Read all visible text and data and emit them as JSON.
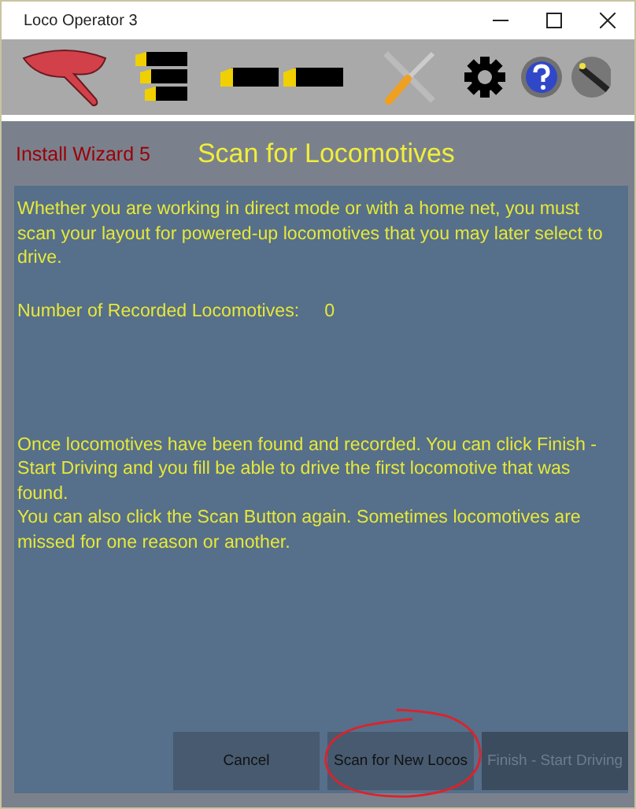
{
  "window": {
    "title": "Loco Operator 3"
  },
  "toolbar": {
    "tools": [
      {
        "kind": "paddle"
      },
      {
        "kind": "trains"
      },
      {
        "kind": "locos"
      },
      {
        "kind": "tools"
      },
      {
        "kind": "gear"
      },
      {
        "kind": "help"
      },
      {
        "kind": "wand"
      }
    ]
  },
  "header": {
    "step": "Install Wizard 5",
    "title": "Scan for Locomotives"
  },
  "panel": {
    "intro": "Whether you are working in direct mode or with a home net, you must scan your layout for powered-up locomotives that you may later select to drive.",
    "count_label": "Number of Recorded Locomotives:",
    "count_value": "0",
    "notes": [
      "Once locomotives have been found and recorded. You can click Finish - Start Driving and you fill be able to drive  the first locomotive that was found.",
      "You can also click the Scan Button again. Sometimes locomotives are missed for one reason or another."
    ]
  },
  "buttons": [
    {
      "label": "Cancel",
      "disabled": false,
      "circled": false
    },
    {
      "label": "Scan for New Locos",
      "disabled": false,
      "circled": true
    },
    {
      "label": "Finish - Start Driving",
      "disabled": true,
      "circled": false
    }
  ]
}
